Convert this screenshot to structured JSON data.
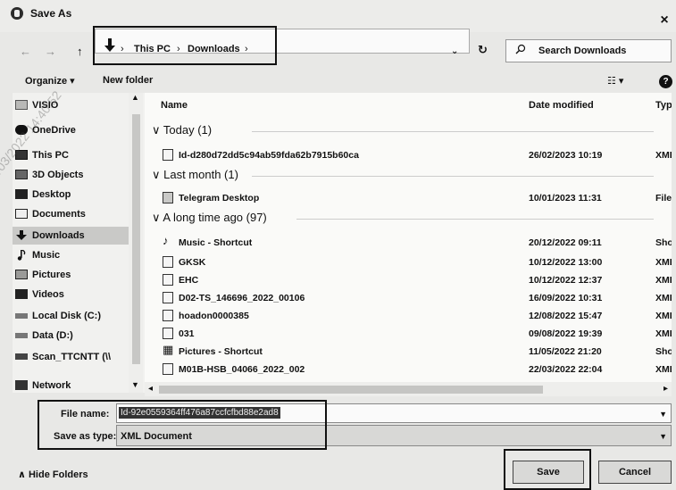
{
  "window": {
    "title": "Save As",
    "close_glyph": "×"
  },
  "nav": {
    "back_glyph": "←",
    "forward_glyph": "→",
    "up_glyph": "↑",
    "location_glyph": "🡇",
    "breadcrumb": [
      "This PC",
      "Downloads"
    ],
    "sep": "›",
    "dropdown_glyph": "⌄",
    "refresh_glyph": "↻",
    "search_placeholder": "Search Downloads",
    "search_glyph": "⚲"
  },
  "toolbar": {
    "organize": "Organize ▾",
    "new_folder": "New folder",
    "view": "☷ ▾",
    "help": "?"
  },
  "sidebar": {
    "items": [
      {
        "label": "VISIO",
        "icon": "folder-icon"
      },
      {
        "label": "OneDrive",
        "icon": "cloud-icon"
      },
      {
        "label": "This PC",
        "icon": "computer-icon"
      },
      {
        "label": "3D Objects",
        "icon": "cube-icon"
      },
      {
        "label": "Desktop",
        "icon": "desktop-icon"
      },
      {
        "label": "Documents",
        "icon": "documents-icon"
      },
      {
        "label": "Downloads",
        "icon": "download-icon"
      },
      {
        "label": "Music",
        "icon": "music-icon"
      },
      {
        "label": "Pictures",
        "icon": "pictures-icon"
      },
      {
        "label": "Videos",
        "icon": "videos-icon"
      },
      {
        "label": "Local Disk (C:)",
        "icon": "drive-icon"
      },
      {
        "label": "Data (D:)",
        "icon": "drive-icon"
      },
      {
        "label": "Scan_TTCNTT (\\\\",
        "icon": "network-drive-icon"
      },
      {
        "label": "Network",
        "icon": "network-icon"
      }
    ],
    "selected": "Downloads"
  },
  "columns": {
    "name": "Name",
    "date": "Date modified",
    "type": "Type"
  },
  "groups": [
    {
      "label": "∨ Today (1)",
      "rows": [
        {
          "name": "Id-d280d72dd5c94ab59fda62b7915b60ca",
          "date": "26/02/2023 10:19",
          "type": "XML",
          "icon": "xml-file-icon"
        }
      ]
    },
    {
      "label": "∨ Last month (1)",
      "rows": [
        {
          "name": "Telegram Desktop",
          "date": "10/01/2023 11:31",
          "type": "File f",
          "icon": "folder-icon"
        }
      ]
    },
    {
      "label": "∨ A long time ago (97)",
      "rows": [
        {
          "name": "Music - Shortcut",
          "date": "20/12/2022 09:11",
          "type": "Shor",
          "icon": "music-shortcut-icon"
        },
        {
          "name": "GKSK",
          "date": "10/12/2022 13:00",
          "type": "XML",
          "icon": "xml-file-icon"
        },
        {
          "name": "EHC",
          "date": "10/12/2022 12:37",
          "type": "XML",
          "icon": "xml-file-icon"
        },
        {
          "name": "D02-TS_146696_2022_00106",
          "date": "16/09/2022 10:31",
          "type": "XML",
          "icon": "xml-file-icon"
        },
        {
          "name": "hoadon0000385",
          "date": "12/08/2022 15:47",
          "type": "XML",
          "icon": "xml-file-icon"
        },
        {
          "name": "031",
          "date": "09/08/2022 19:39",
          "type": "XML",
          "icon": "xml-file-icon"
        },
        {
          "name": "Pictures - Shortcut",
          "date": "11/05/2022 21:20",
          "type": "Shor",
          "icon": "pictures-shortcut-icon"
        },
        {
          "name": "M01B-HSB_04066_2022_002",
          "date": "22/03/2022 22:04",
          "type": "XML",
          "icon": "xml-file-icon"
        }
      ]
    }
  ],
  "form": {
    "file_name_label": "File name:",
    "file_name_value": "Id-92e0559364ff476a87ccfcfbd88e2ad8",
    "save_type_label": "Save as type:",
    "save_type_value": "XML Document"
  },
  "footer": {
    "hide_folders": "∧ Hide Folders",
    "save": "Save",
    "cancel": "Cancel"
  },
  "watermark": "08/03/2022 14:40:52"
}
